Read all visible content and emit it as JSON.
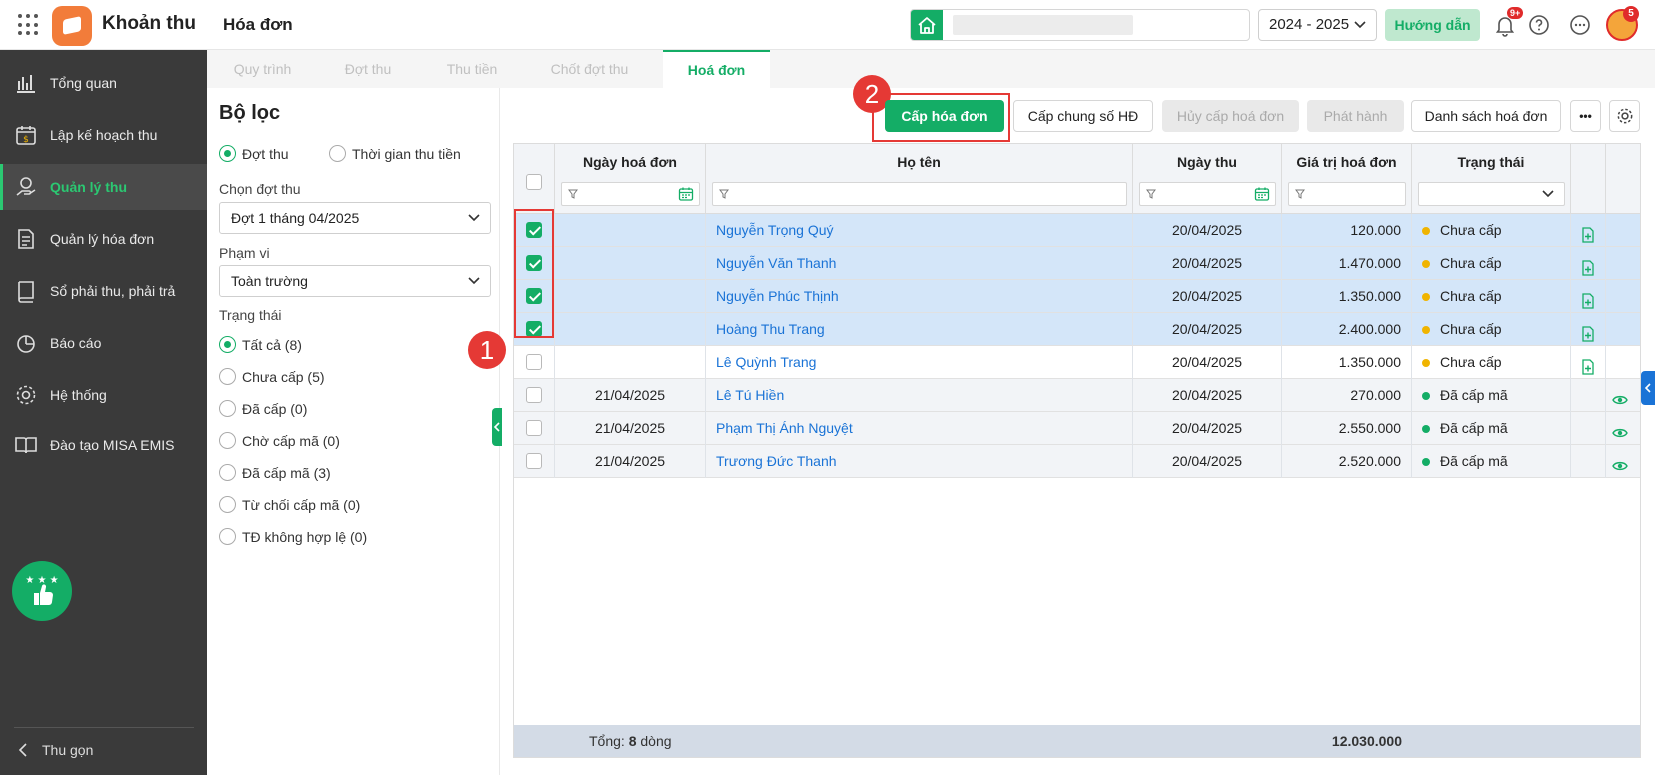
{
  "app": {
    "name": "Khoản thu",
    "page_title": "Hóa đơn",
    "school_placeholder": "",
    "school_year": "2024 - 2025",
    "guide_label": "Hướng dẫn",
    "notifications_badge": "9+",
    "avatar_badge": "5"
  },
  "sidebar": {
    "items": [
      {
        "label": "Tổng quan",
        "icon": "chart-bars-icon"
      },
      {
        "label": "Lập kế hoạch thu",
        "icon": "calendar-money-icon"
      },
      {
        "label": "Quản lý thu",
        "icon": "money-hand-icon"
      },
      {
        "label": "Quản lý hóa đơn",
        "icon": "document-icon"
      },
      {
        "label": "Sổ phải thu, phải trả",
        "icon": "ledger-icon"
      },
      {
        "label": "Báo cáo",
        "icon": "pie-chart-icon"
      },
      {
        "label": "Hệ thống",
        "icon": "gear-icon"
      },
      {
        "label": "Đào tạo MISA EMIS",
        "icon": "book-icon"
      }
    ],
    "active_index": 2,
    "collapse_label": "Thu gọn"
  },
  "tabs": [
    {
      "label": "Quy trình"
    },
    {
      "label": "Đợt thu"
    },
    {
      "label": "Thu tiền"
    },
    {
      "label": "Chốt đợt thu"
    },
    {
      "label": "Hoá đơn"
    }
  ],
  "filter": {
    "title": "Bộ lọc",
    "mode_options": [
      "Đợt thu",
      "Thời gian thu tiền"
    ],
    "mode_selected": 0,
    "period_label": "Chọn đợt thu",
    "period_value": "Đợt 1 tháng 04/2025",
    "scope_label": "Phạm vi",
    "scope_value": "Toàn trường",
    "status_label": "Trạng thái",
    "status_options": [
      "Tất cả (8)",
      "Chưa cấp (5)",
      "Đã cấp (0)",
      "Chờ cấp mã (0)",
      "Đã cấp mã (3)",
      "Từ chối cấp mã (0)",
      "TĐ không hợp lệ (0)"
    ],
    "status_selected": 0
  },
  "toolbar": {
    "issue_invoice": "Cấp hóa đơn",
    "issue_common_number": "Cấp chung số HĐ",
    "cancel_issue": "Hủy cấp hoá đơn",
    "publish": "Phát hành",
    "invoice_list": "Danh sách hoá đơn",
    "more": "•••"
  },
  "annotations": {
    "step1": "1",
    "step2": "2"
  },
  "table": {
    "columns": [
      "Ngày hoá đơn",
      "Họ tên",
      "Ngày thu",
      "Giá trị hoá đơn",
      "Trạng thái"
    ],
    "rows": [
      {
        "checked": true,
        "invoice_date": "",
        "name": "Nguyễn Trọng Quý",
        "paid_date": "20/04/2025",
        "amount": "120.000",
        "status": "Chưa cấp",
        "status_color": "#f0b400",
        "action": "add-invoice-icon"
      },
      {
        "checked": true,
        "invoice_date": "",
        "name": "Nguyễn Văn Thanh",
        "paid_date": "20/04/2025",
        "amount": "1.470.000",
        "status": "Chưa cấp",
        "status_color": "#f0b400",
        "action": "add-invoice-icon"
      },
      {
        "checked": true,
        "invoice_date": "",
        "name": "Nguyễn Phúc Thịnh",
        "paid_date": "20/04/2025",
        "amount": "1.350.000",
        "status": "Chưa cấp",
        "status_color": "#f0b400",
        "action": "add-invoice-icon"
      },
      {
        "checked": true,
        "invoice_date": "",
        "name": "Hoàng Thu Trang",
        "paid_date": "20/04/2025",
        "amount": "2.400.000",
        "status": "Chưa cấp",
        "status_color": "#f0b400",
        "action": "add-invoice-icon"
      },
      {
        "checked": false,
        "invoice_date": "",
        "name": "Lê Quỳnh Trang",
        "paid_date": "20/04/2025",
        "amount": "1.350.000",
        "status": "Chưa cấp",
        "status_color": "#f0b400",
        "action": "add-invoice-icon"
      },
      {
        "checked": false,
        "invoice_date": "21/04/2025",
        "name": "Lê Tú Hiền",
        "paid_date": "20/04/2025",
        "amount": "270.000",
        "status": "Đã cấp mã",
        "status_color": "#14ad66",
        "action": "eye-icon"
      },
      {
        "checked": false,
        "invoice_date": "21/04/2025",
        "name": "Phạm Thị Ánh Nguyệt",
        "paid_date": "20/04/2025",
        "amount": "2.550.000",
        "status": "Đã cấp mã",
        "status_color": "#14ad66",
        "action": "eye-icon"
      },
      {
        "checked": false,
        "invoice_date": "21/04/2025",
        "name": "Trương Đức Thanh",
        "paid_date": "20/04/2025",
        "amount": "2.520.000",
        "status": "Đã cấp mã",
        "status_color": "#14ad66",
        "action": "eye-icon"
      }
    ],
    "footer_prefix": "Tổng:",
    "footer_count": "8",
    "footer_suffix": "dòng",
    "footer_total": "12.030.000"
  },
  "colors": {
    "accent": "#14ad66",
    "link": "#1a73d6",
    "highlight": "#e53935",
    "selected_row": "#d4e6f9"
  }
}
